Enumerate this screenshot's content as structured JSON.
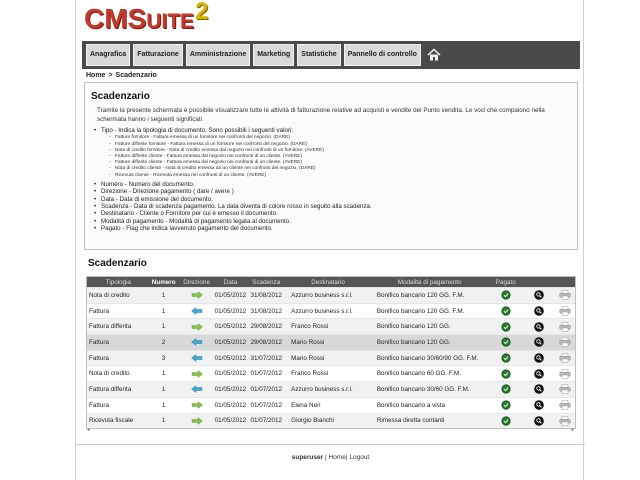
{
  "app": {
    "logo_text_big_c": "CM",
    "logo_text_s": "S",
    "logo_text_uite": "UITE",
    "logo_num": "2"
  },
  "nav": {
    "items": [
      {
        "label": "Anagrafica"
      },
      {
        "label": "Fatturazione"
      },
      {
        "label": "Amministrazione"
      },
      {
        "label": "Marketing"
      },
      {
        "label": "Statistiche"
      },
      {
        "label": "Pannello di controllo"
      }
    ]
  },
  "breadcrumb": {
    "home": "Home",
    "sep": ">",
    "current": "Scadenzario"
  },
  "help": {
    "title": "Scadenzario",
    "intro": "Tramite la presente schermata è possibile visualizzare tutte le attività di fatturazione relative ad acquisti e vendite del Punto vendita. Le voci che compaiono nella schermata hanno i seguenti significati",
    "tipo": "Tipo - Indica la tipologia di documento. Sono possibili i seguenti valori:",
    "tipo_values": [
      "Fatture fornitore - Fattura emessa di un fornitore nei confronti del negozio. (DARE)",
      "Fatture differite fornitore - Fattura emessa di un fornitore nei confronti del negozio. (DARE)",
      "Nota di credito fornitore - Nota di credito emessa dal negozio nei confronti di un fornitore. (AVERE)",
      "Fatture differite cliente - Fattura emessa dal negozio nei confronti di un cliente. (AVERE)",
      "Fatture differite cliente - Fattura emessa dal negozio nei confronti di un cliente. (AVERE)",
      "Nota di credito cliente - Nota di credito emessa da un cliente nei confronti del negozio. (DARE)",
      "Ricevuta cliente - Ricevuta emessa nei confronti di un cliente. (AVERE)"
    ],
    "others": [
      "Numero - Numero del documento.",
      "Direzione - Direzione pagamento ( dare / avere )",
      "Data - Data di emissione del documento.",
      "Scadenza - Data di scadenza pagamento. La data diventa di colore rosso in seguito alla scadenza.",
      "Destinatario - Cliente o Fornitore per cui è emesso il documento.",
      "Modalità di pagamento - Modalità di pagamento legata al documento.",
      "Pagato - Flag che indica lavvenuto pagamento del documento."
    ]
  },
  "table": {
    "title": "Scadenzario",
    "headers": {
      "tipologia": "Tipologia",
      "numero": "Numero",
      "direzione": "Direzione",
      "data": "Data",
      "scadenza": "Scadenza",
      "destinatario": "Destinatario",
      "modalita": "Modalità di pagamento",
      "pagato": "Pagato"
    },
    "rows": [
      {
        "tipologia": "Nota di credito",
        "numero": "1",
        "direzione": "in",
        "data": "01/05/2012",
        "scadenza": "31/08/2012",
        "destinatario": "Azzurro business s.r.l.",
        "modalita": "Bonifico bancario 120 GG. F.M."
      },
      {
        "tipologia": "Fattura",
        "numero": "1",
        "direzione": "out",
        "data": "01/05/2012",
        "scadenza": "31/08/2012",
        "destinatario": "Azzurro business s.r.l.",
        "modalita": "Bonifico bancario 120 GG. F.M."
      },
      {
        "tipologia": "Fattura differita",
        "numero": "1",
        "direzione": "in",
        "data": "01/05/2012",
        "scadenza": "29/08/2012",
        "destinatario": "Franco Rossi",
        "modalita": "Bonifico bancario 120 GG."
      },
      {
        "tipologia": "Fattura",
        "numero": "2",
        "direzione": "out",
        "data": "01/05/2012",
        "scadenza": "29/08/2012",
        "destinatario": "Mario Rossi",
        "modalita": "Bonifico bancario 120 GG."
      },
      {
        "tipologia": "Fattura",
        "numero": "3",
        "direzione": "out",
        "data": "01/05/2012",
        "scadenza": "31/07/2012",
        "destinatario": "Mario Rossi",
        "modalita": "Bonifico bancario 30/60/90 GG. F.M."
      },
      {
        "tipologia": "Nota di credito",
        "numero": "1",
        "direzione": "in",
        "data": "01/05/2012",
        "scadenza": "01/07/2012",
        "destinatario": "Franco Rossi",
        "modalita": "Bonifico bancario 60 GG. F.M."
      },
      {
        "tipologia": "Fattura differita",
        "numero": "1",
        "direzione": "out",
        "data": "01/05/2012",
        "scadenza": "01/07/2012",
        "destinatario": "Azzurro business s.r.l.",
        "modalita": "Bonifico bancario 30/60 GG. F.M."
      },
      {
        "tipologia": "Fattura",
        "numero": "1",
        "direzione": "in",
        "data": "01/05/2012",
        "scadenza": "01/07/2012",
        "destinatario": "Elena Neri",
        "modalita": "Bonifico bancario a vista"
      },
      {
        "tipologia": "Ricevuta fiscale",
        "numero": "1",
        "direzione": "in",
        "data": "01/05/2012",
        "scadenza": "01/07/2012",
        "destinatario": "Giorgio Bianchi",
        "modalita": "Rimessa diretta contanti"
      }
    ]
  },
  "footer": {
    "user": "superuser",
    "sep": "|",
    "home": "Home",
    "logout": "Logout"
  },
  "colors": {
    "logo_red": "#c0392b",
    "logo_gold": "#d9b300",
    "nav_bg": "#4a4a4a",
    "arrow_green": "#8bc34a",
    "arrow_blue": "#3fa9d8",
    "paid_green": "#2e7d32"
  },
  "icons": {
    "home": "home-icon",
    "dir_in": "arrow-right-icon",
    "dir_out": "arrow-left-icon",
    "paid": "check-circle-icon",
    "view": "magnifier-icon",
    "print": "printer-icon"
  }
}
